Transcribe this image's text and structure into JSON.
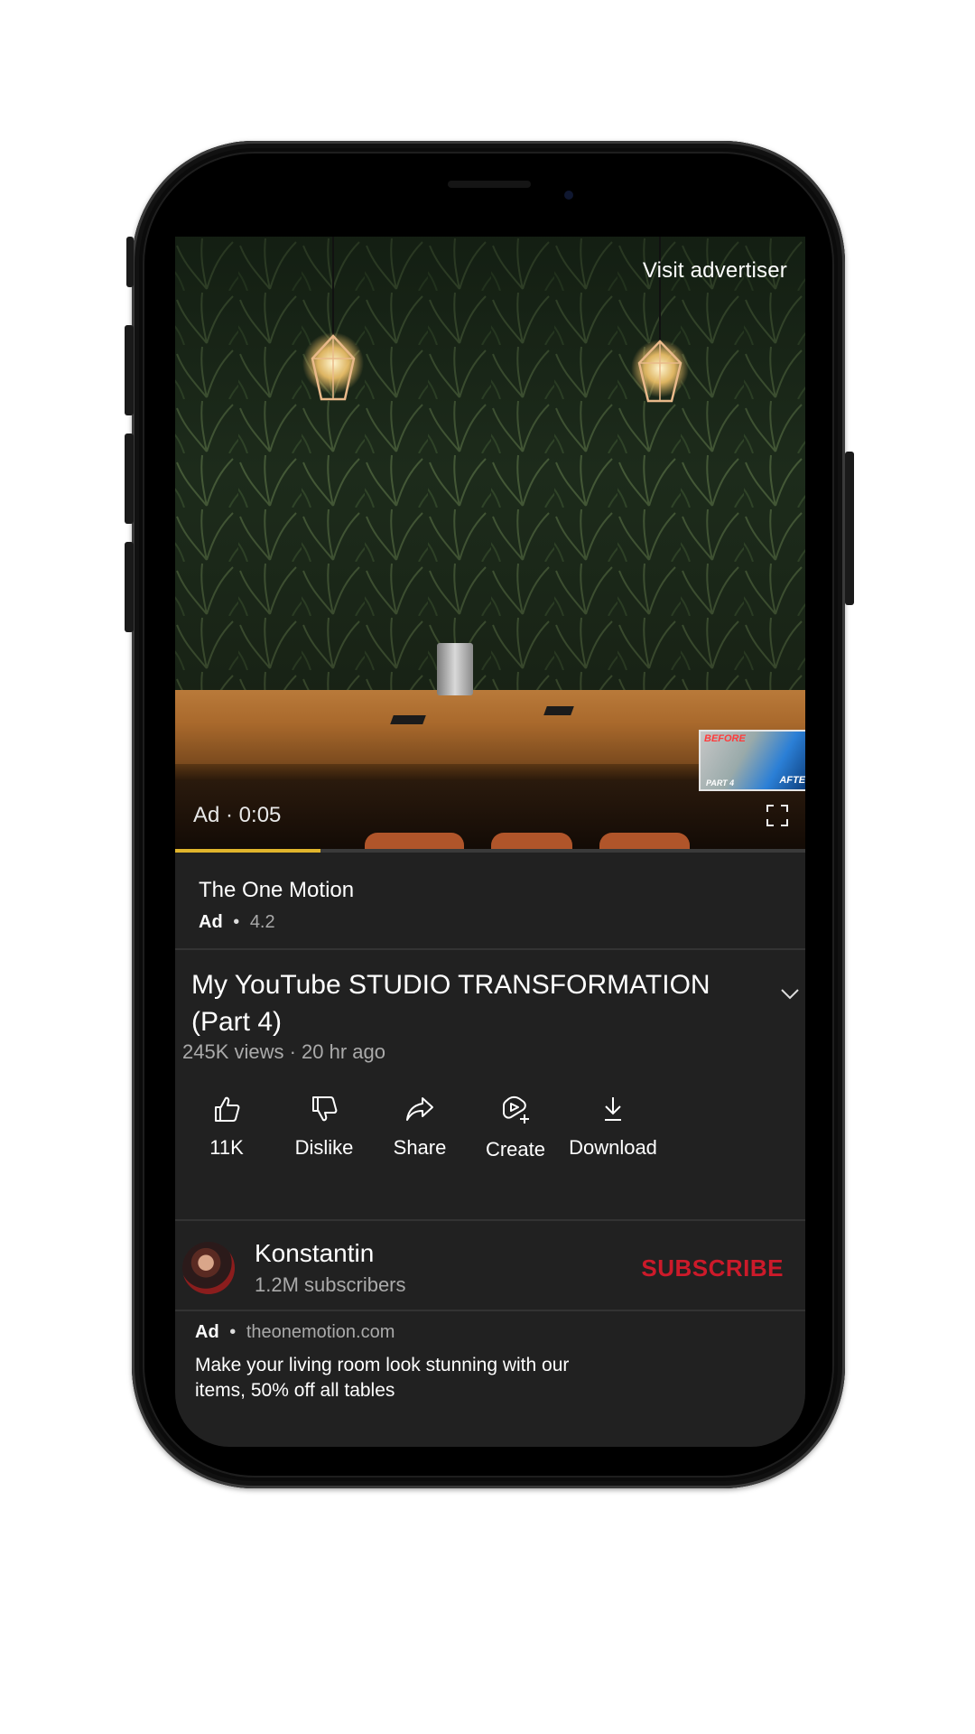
{
  "video": {
    "visit_advertiser": "Visit advertiser",
    "ad_timer": "Ad · 0:05",
    "progress_fraction": 0.23,
    "thumbnail_text": {
      "before": "BEFORE",
      "after": "AFTER",
      "part": "PART 4"
    }
  },
  "advertiser": {
    "name": "The One Motion",
    "ad_label": "Ad",
    "rating": "4.2"
  },
  "video_info": {
    "title": "My YouTube STUDIO TRANSFORMATION (Part 4)",
    "meta": "245K views · 20 hr ago"
  },
  "actions": [
    {
      "label": "11K",
      "icon": "thumbs-up-icon"
    },
    {
      "label": "Dislike",
      "icon": "thumbs-down-icon"
    },
    {
      "label": "Share",
      "icon": "share-icon"
    },
    {
      "label": "Create",
      "icon": "create-icon"
    },
    {
      "label": "Download",
      "icon": "download-icon"
    }
  ],
  "channel": {
    "name": "Konstantin",
    "subscribers": "1.2M subscribers",
    "subscribe_label": "SUBSCRIBE"
  },
  "promo": {
    "ad_label": "Ad",
    "domain": "theonemotion.com",
    "text": "Make your living room look stunning with our items, 50% off all tables"
  },
  "colors": {
    "panel_bg": "#212121",
    "subscribe_red": "#cc1a2a",
    "progress_yellow": "#e1b52c"
  }
}
